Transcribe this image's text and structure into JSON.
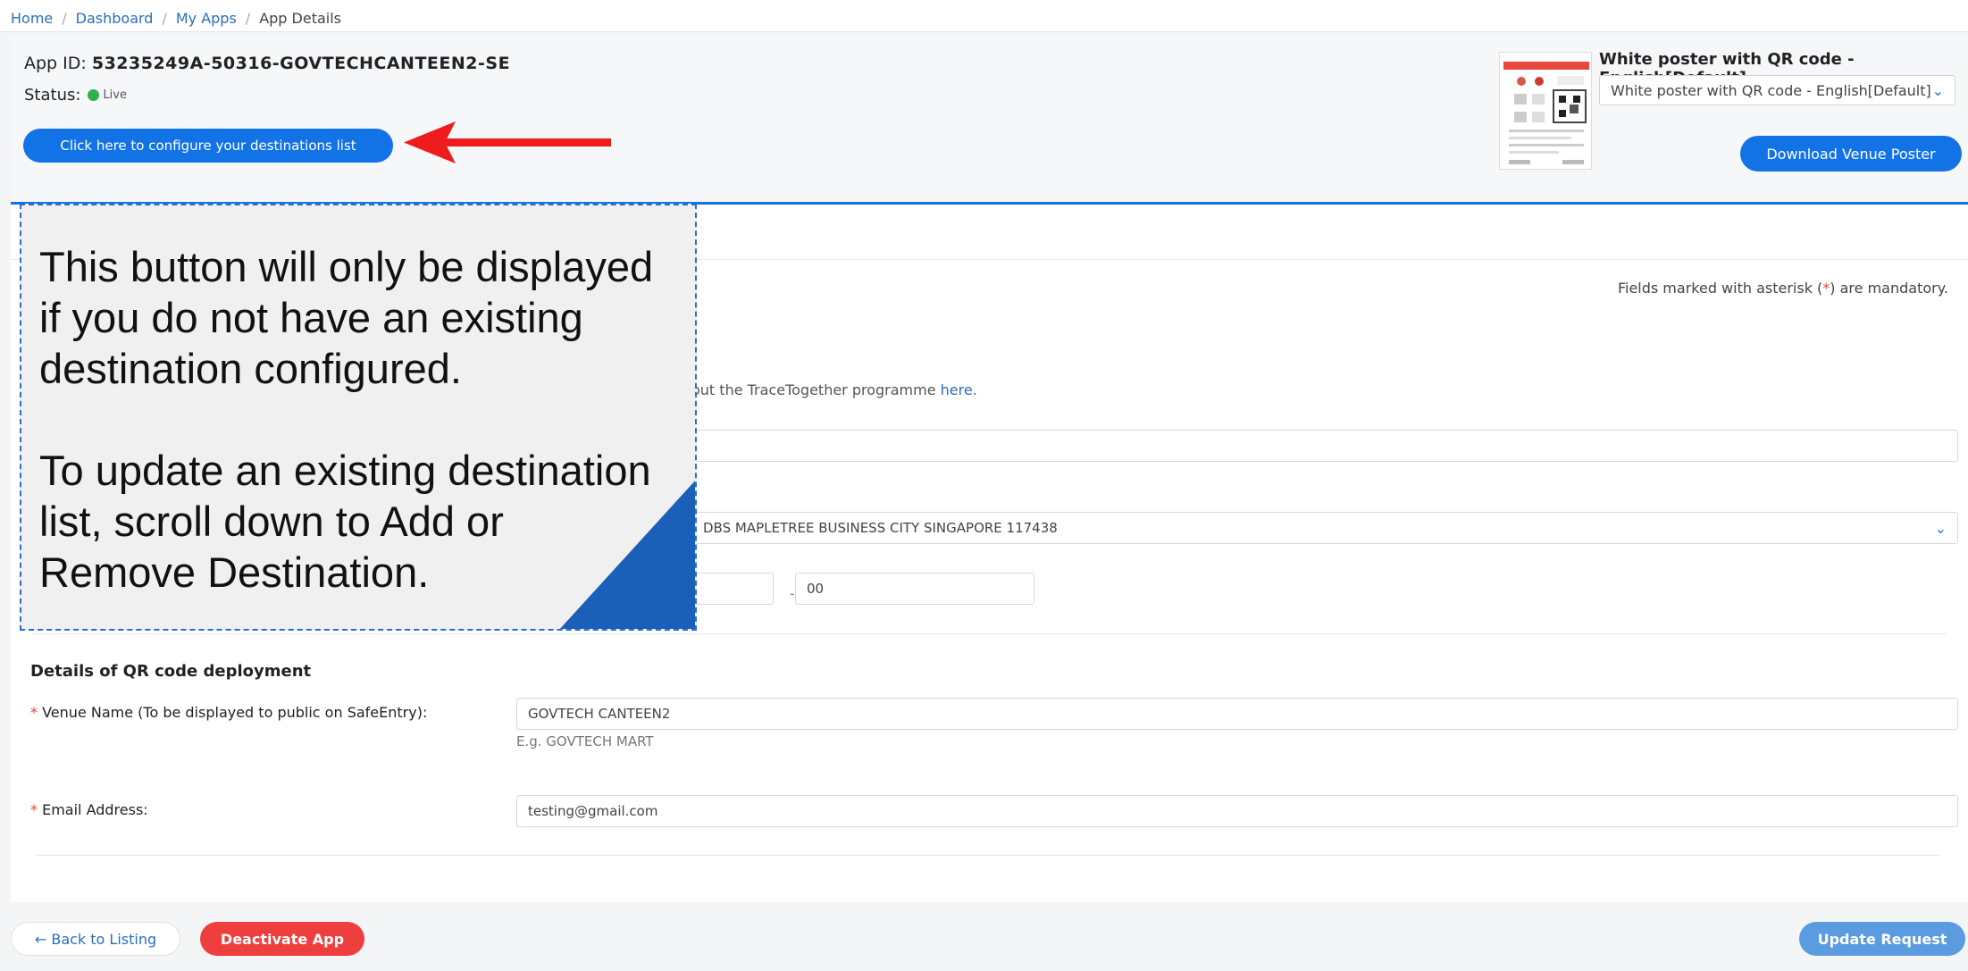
{
  "breadcrumb": {
    "items": [
      "Home",
      "Dashboard",
      "My Apps",
      "App Details"
    ],
    "separator": "/"
  },
  "app": {
    "id_label": "App ID:",
    "id_value": "53235249A-50316-GOVTECHCANTEEN2-SE",
    "status_label": "Status:",
    "status_value": "Live",
    "status_color": "#2bb24c"
  },
  "config_button": {
    "label": "Click here to configure your destinations list"
  },
  "poster": {
    "title": "White poster with QR code - English[Default]",
    "selected_option": "White poster with QR code - English[Default]",
    "download_label": "Download Venue Poster"
  },
  "form": {
    "mandatory_note_prefix": "Fields marked with asterisk (",
    "mandatory_star": "*",
    "mandatory_note_suffix": ") are mandatory.",
    "trace_text": "out the TraceTogether programme ",
    "trace_link": "here.",
    "address_value": "DBS MAPLETREE BUSINESS CITY SINGAPORE 117438",
    "time_value": "00",
    "time_separator": "-",
    "section_title": "Details of QR code deployment",
    "venue_label": "Venue Name (To be displayed to public on SafeEntry):",
    "venue_value": "GOVTECH CANTEEN2",
    "venue_helper": "E.g. GOVTECH MART",
    "email_label": "Email Address:",
    "email_value": "testing@gmail.com"
  },
  "overlay": {
    "text": "This button will only be displayed\nif you do not have an existing\ndestination configured.\n\nTo update an existing destination\nlist, scroll down to Add or\nRemove Destination."
  },
  "footer": {
    "back_label": "← Back to Listing",
    "deactivate_label": "Deactivate App",
    "update_label": "Update Request"
  },
  "colors": {
    "accent": "#1273e6",
    "danger": "#ef3e3e",
    "arrow": "#ee1c1c",
    "overlay_border": "#2d6fc6"
  }
}
